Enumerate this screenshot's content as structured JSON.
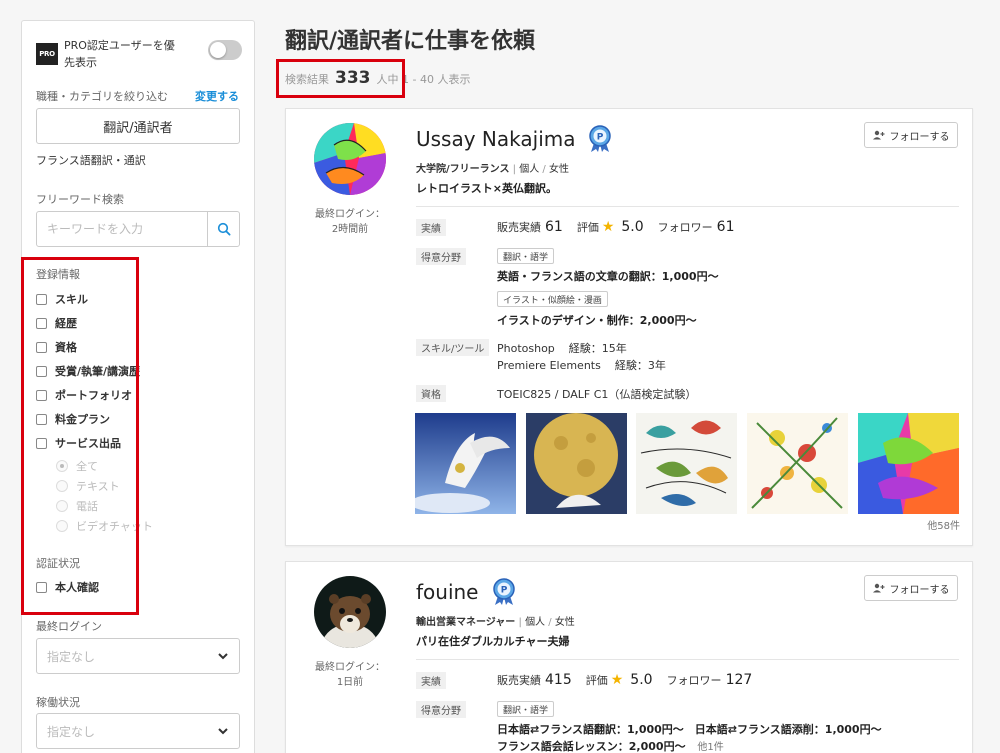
{
  "sidebar": {
    "pro_badge": "PRO",
    "pro_toggle_label": "PRO認定ユーザーを優先表示",
    "category_label": "職種・カテゴリを絞り込む",
    "change_link": "変更する",
    "category_value": "翻訳/通訳者",
    "sub_category": "フランス語翻訳・通訳",
    "freeword_label": "フリーワード検索",
    "search_placeholder": "キーワードを入力",
    "registration_label": "登録情報",
    "registration_items": [
      "スキル",
      "経歴",
      "資格",
      "受賞/執筆/講演歴",
      "ポートフォリオ",
      "料金プラン",
      "サービス出品"
    ],
    "service_options": [
      "全て",
      "テキスト",
      "電話",
      "ビデオチャット"
    ],
    "verification_label": "認証状況",
    "verification_items": [
      "本人確認"
    ],
    "last_login_label": "最終ログイン",
    "last_login_value": "指定なし",
    "status_label": "稼働状況",
    "status_value": "指定なし"
  },
  "main": {
    "title": "翻訳/通訳者に仕事を依頼",
    "result_label": "検索結果",
    "result_count": "333",
    "result_range": "人中 1 - 40 人表示"
  },
  "users": [
    {
      "name": "Ussay Nakajima",
      "follow_label": "フォローする",
      "last_login_label": "最終ログイン：",
      "last_login_value": "2時間前",
      "occupation": "大学院/フリーランス",
      "type": "個人",
      "gender": "女性",
      "catchphrase": "レトロイラスト×英仏翻訳。",
      "stats_tag": "実績",
      "sales_label": "販売実績",
      "sales_value": "61",
      "rating_label": "評価",
      "rating_value": "5.0",
      "follower_label": "フォロワー",
      "follower_value": "61",
      "specialty_tag": "得意分野",
      "specialties": [
        {
          "category": "翻訳・語学",
          "item": "英語・フランス語の文章の翻訳：1,000円〜"
        },
        {
          "category": "イラスト・似顔絵・漫画",
          "item": "イラストのデザイン・制作：2,000円〜"
        }
      ],
      "skills_tag": "スキル/ツール",
      "skills": [
        {
          "name": "Photoshop",
          "experience": "経験：15年"
        },
        {
          "name": "Premiere Elements",
          "experience": "経験：3年"
        }
      ],
      "qualification_tag": "資格",
      "qualification": "TOEIC825 / DALF C1（仏語検定試験）",
      "portfolio_more": "他58件"
    },
    {
      "name": "fouine",
      "follow_label": "フォローする",
      "last_login_label": "最終ログイン：",
      "last_login_value": "1日前",
      "occupation": "輸出営業マネージャー",
      "type": "個人",
      "gender": "女性",
      "catchphrase": "パリ在住ダブルカルチャー夫婦",
      "stats_tag": "実績",
      "sales_label": "販売実績",
      "sales_value": "415",
      "rating_label": "評価",
      "rating_value": "5.0",
      "follower_label": "フォロワー",
      "follower_value": "127",
      "specialty_tag": "得意分野",
      "specialty_category": "翻訳・語学",
      "specialty_line1": "日本語⇄フランス語翻訳：1,000円〜　日本語⇄フランス語添削：1,000円〜",
      "specialty_line2": "フランス語会話レッスン：2,000円〜",
      "specialty_more": "他1件"
    }
  ]
}
